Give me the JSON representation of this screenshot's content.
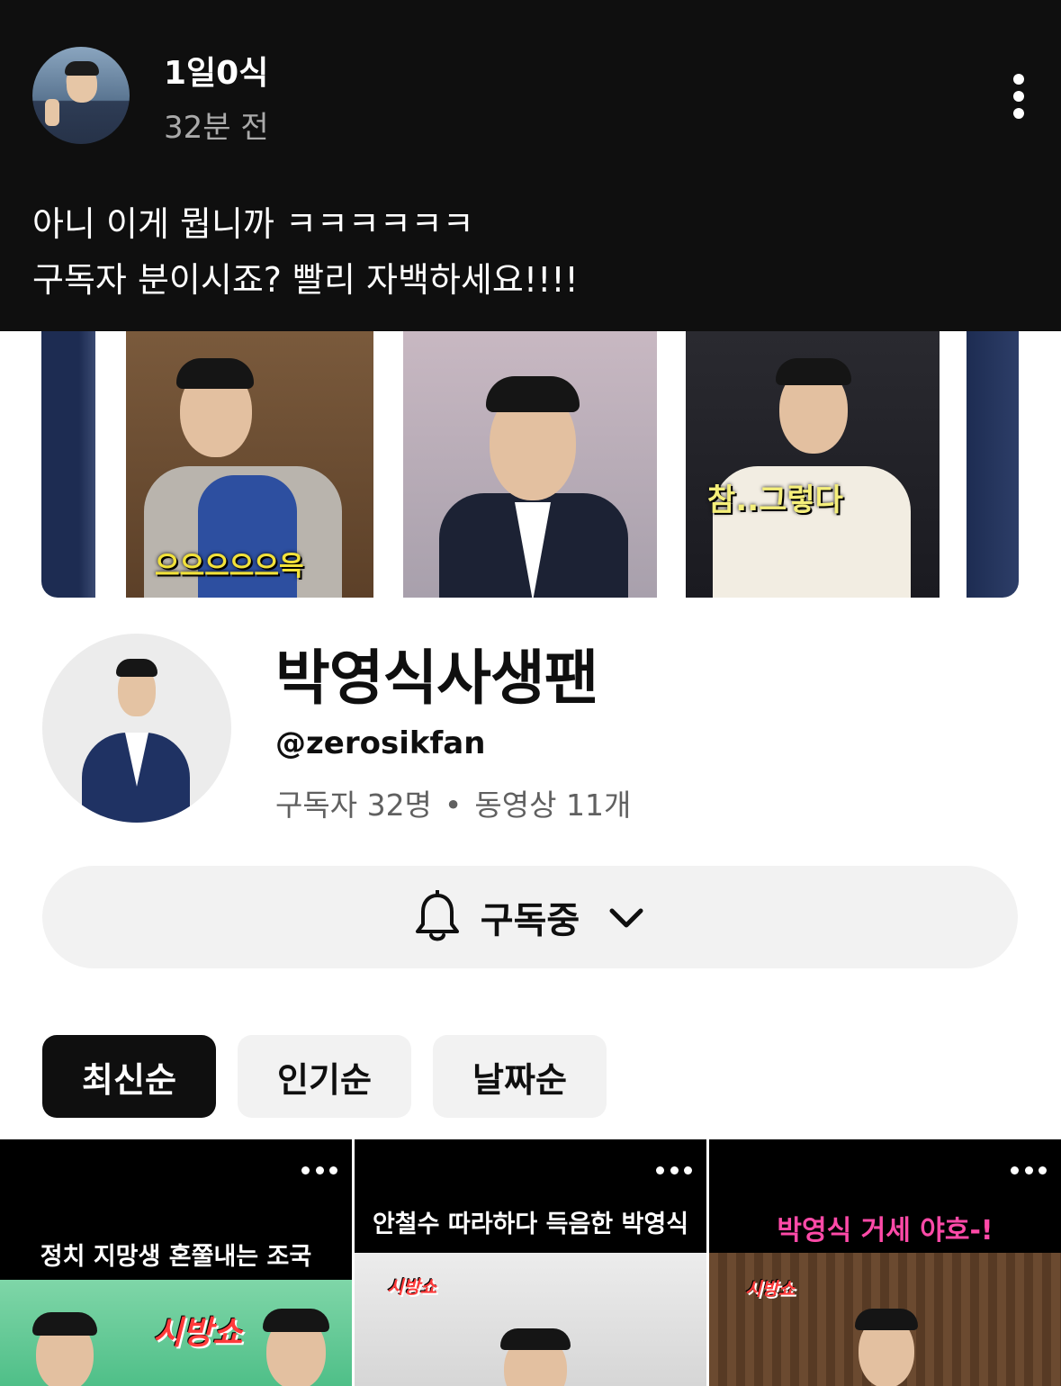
{
  "post": {
    "author": "1일0식",
    "time": "32분 전",
    "line1": "아니 이게 뭡니까 ㅋㅋㅋㅋㅋㅋ",
    "line2": "구독자 분이시죠? 빨리 자백하세요!!!!"
  },
  "banner": {
    "caption_left": "으으으으으윽",
    "caption_right": "참..그렇다"
  },
  "channel": {
    "name": "박영식사생팬",
    "handle": "@zerosikfan",
    "subscribers": "구독자 32명",
    "separator": "•",
    "videos": "동영상 11개",
    "subscribe_label": "구독중"
  },
  "chips": [
    "최신순",
    "인기순",
    "날짜순"
  ],
  "shorts": [
    {
      "title": "정치 지망생 혼쭐내는 조국",
      "logo": "시방쇼"
    },
    {
      "title": "안철수 따라하다 득음한 박영식",
      "logo": "시방쇼"
    },
    {
      "title": "박영식 거세 야호-!",
      "logo": "시방쇼"
    }
  ],
  "colors": {
    "dark_bg": "#0f0f0f",
    "chip_bg": "#f2f2f2",
    "pink_title": "#ff4aa8",
    "caption_yellow": "#f2e23a"
  },
  "icons": [
    "more-vert-icon",
    "bell-icon",
    "chevron-down-icon",
    "more-horiz-icon"
  ]
}
